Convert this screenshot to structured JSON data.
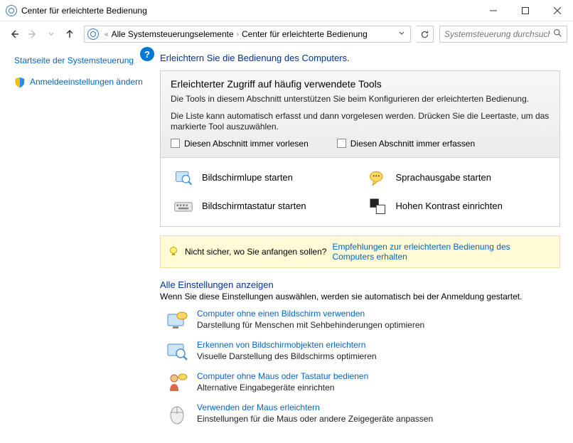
{
  "window": {
    "title": "Center für erleichterte Bedienung"
  },
  "breadcrumbs": {
    "prefix": "«",
    "item1": "Alle Systemsteuerungselemente",
    "item2": "Center für erleichterte Bedienung"
  },
  "search": {
    "placeholder": "Systemsteuerung durchsuchen"
  },
  "sidebar": {
    "link_home": "Startseite der Systemsteuerung",
    "link_login": "Anmeldeeinstellungen ändern"
  },
  "main": {
    "heading": "Erleichtern Sie die Bedienung des Computers.",
    "panel": {
      "title": "Erleichterter Zugriff auf häufig verwendete Tools",
      "desc1": "Die Tools in diesem Abschnitt unterstützen Sie beim Konfigurieren der erleichterten Bedienung.",
      "desc2": "Die Liste kann automatisch erfasst und dann vorgelesen werden. Drücken Sie die Leertaste, um das markierte Tool auszuwählen.",
      "chk1": "Diesen Abschnitt immer vorlesen",
      "chk2": "Diesen Abschnitt immer erfassen"
    },
    "tools": {
      "magnifier": "Bildschirmlupe starten",
      "narrator": "Sprachausgabe starten",
      "osk": "Bildschirmtastatur starten",
      "contrast": "Hohen Kontrast einrichten"
    },
    "hint": {
      "text": "Nicht sicher, wo Sie anfangen sollen?",
      "link": "Empfehlungen zur erleichterten Bedienung des Computers erhalten"
    },
    "all": {
      "heading": "Alle Einstellungen anzeigen",
      "sub": "Wenn Sie diese Einstellungen auswählen, werden sie automatisch bei der Anmeldung gestartet."
    },
    "settings": [
      {
        "title": "Computer ohne einen Bildschirm verwenden",
        "desc": "Darstellung für Menschen mit Sehbehinderungen optimieren"
      },
      {
        "title": "Erkennen von Bildschirmobjekten erleichtern",
        "desc": "Visuelle Darstellung des Bildschirms optimieren"
      },
      {
        "title": "Computer ohne Maus oder Tastatur bedienen",
        "desc": "Alternative Eingabegeräte einrichten"
      },
      {
        "title": "Verwenden der Maus erleichtern",
        "desc": "Einstellungen für die Maus oder andere Zeigegeräte anpassen"
      }
    ]
  }
}
